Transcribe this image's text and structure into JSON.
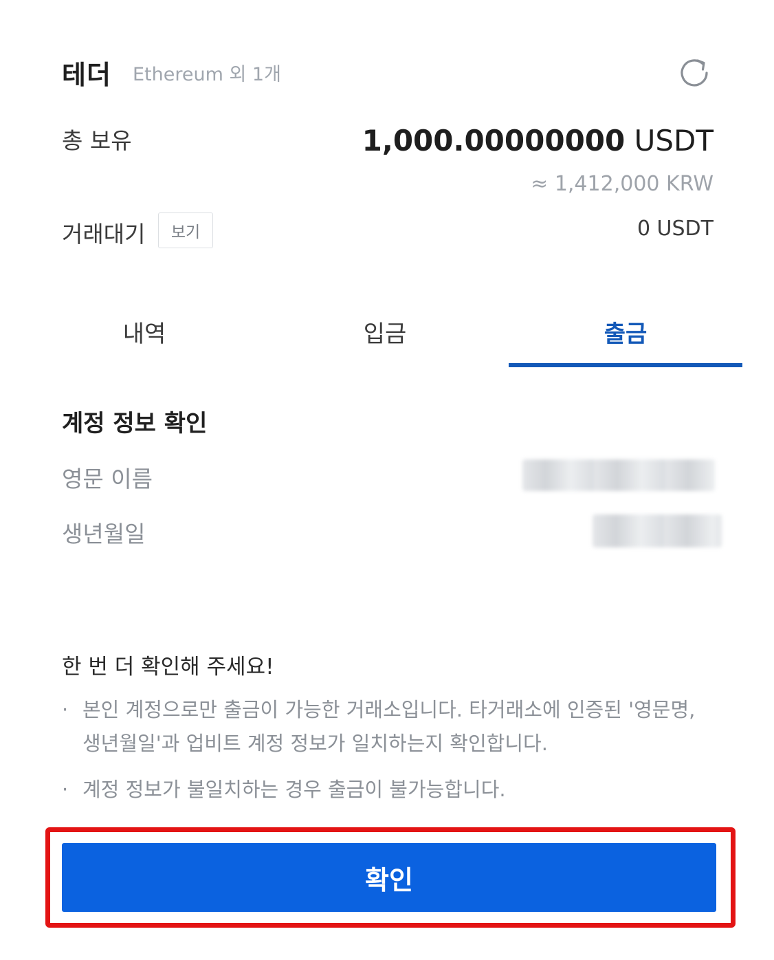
{
  "header": {
    "coin_name": "테더",
    "network": "Ethereum 외 1개",
    "refresh_icon": "refresh-icon"
  },
  "balance": {
    "total_label": "총 보유",
    "total_amount": "1,000.00000000",
    "total_unit": "USDT",
    "krw_equivalent": "≈ 1,412,000 KRW",
    "pending_label": "거래대기",
    "pending_view_label": "보기",
    "pending_amount": "0 USDT"
  },
  "tabs": [
    {
      "label": "내역",
      "active": false
    },
    {
      "label": "입금",
      "active": false
    },
    {
      "label": "출금",
      "active": true
    }
  ],
  "account_info": {
    "title": "계정 정보 확인",
    "english_name_label": "영문 이름",
    "birthdate_label": "생년월일"
  },
  "notice": {
    "title": "한 번 더 확인해 주세요!",
    "items": [
      "본인 계정으로만 출금이 가능한 거래소입니다. 타거래소에 인증된 '영문명, 생년월일'과 업비트 계정 정보가 일치하는지 확인합니다.",
      "계정 정보가 불일치하는 경우 출금이 불가능합니다."
    ],
    "bullet": "·"
  },
  "confirm_button": {
    "label": "확인"
  },
  "colors": {
    "accent": "#1359b8",
    "button": "#0b62e0",
    "highlight": "#e31414"
  }
}
